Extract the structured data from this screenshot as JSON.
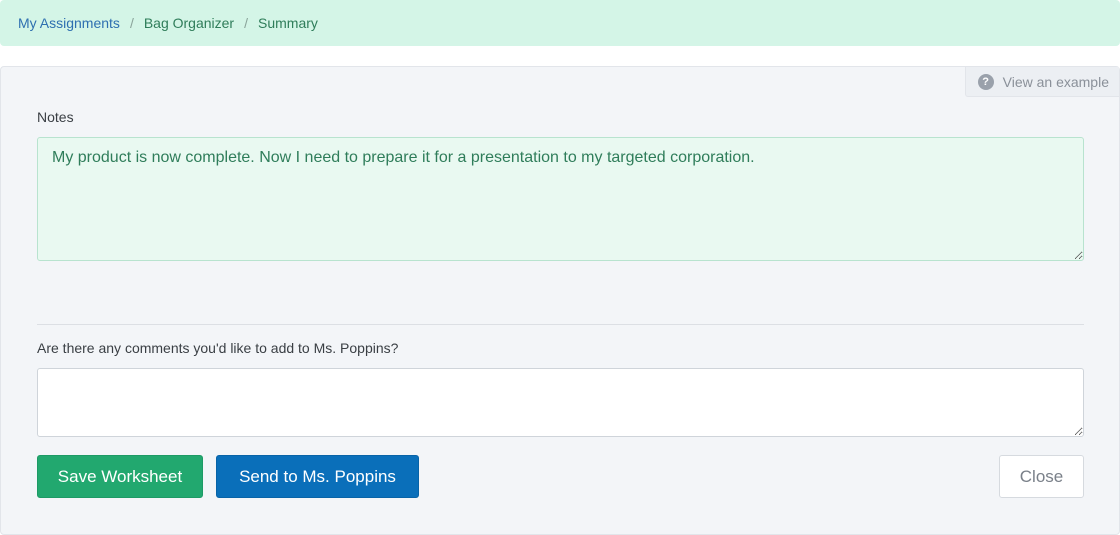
{
  "breadcrumb": {
    "items": [
      {
        "label": "My Assignments"
      },
      {
        "label": "Bag Organizer"
      },
      {
        "label": "Summary"
      }
    ],
    "separator": "/"
  },
  "example_link": {
    "icon": "question-circle-icon",
    "label": "View an example"
  },
  "notes": {
    "label": "Notes",
    "value": "My product is now complete. Now I need to prepare it for a presentation to my targeted corporation."
  },
  "comments": {
    "label": "Are there any comments you'd like to add to Ms. Poppins?",
    "value": "",
    "placeholder": ""
  },
  "buttons": {
    "save": "Save Worksheet",
    "send": "Send to Ms. Poppins",
    "close": "Close"
  },
  "colors": {
    "breadcrumb_bg": "#d4f5e7",
    "save_button": "#22a86f",
    "send_button": "#0a6fba",
    "notes_text": "#2f7d5a"
  }
}
